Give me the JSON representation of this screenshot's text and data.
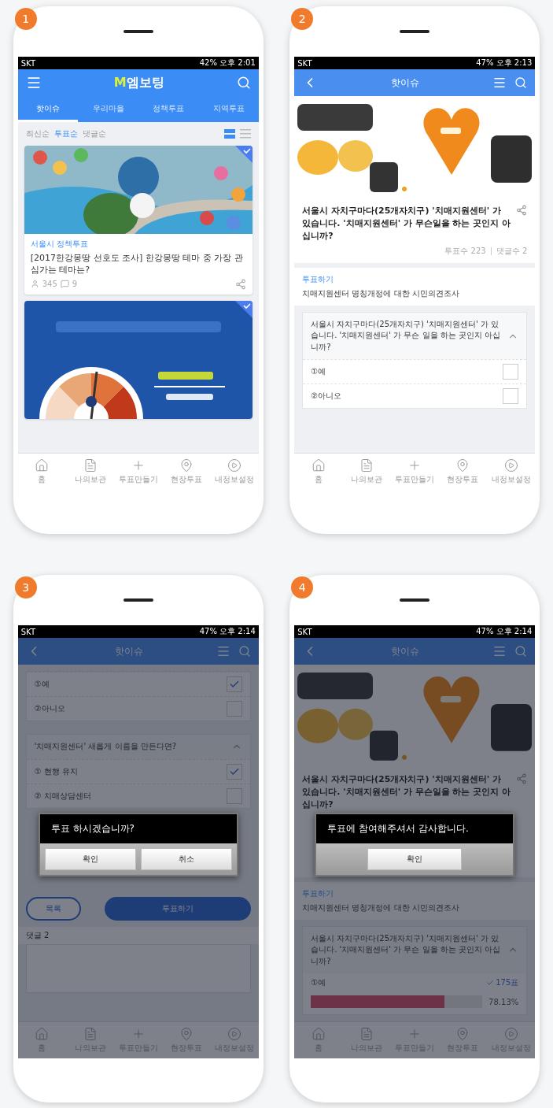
{
  "phones": [
    {
      "number": "1",
      "kind": "list",
      "status_bar": {
        "carrier": "SKT",
        "info": "42% 오후 2:01"
      },
      "app_bar": {
        "logo_mark": "M",
        "logo_text": "엠보팅"
      },
      "tabs": [
        {
          "label": "핫이슈",
          "selected": true
        },
        {
          "label": "우리마을",
          "selected": false
        },
        {
          "label": "정책투표",
          "selected": false
        },
        {
          "label": "지역투표",
          "selected": false
        }
      ],
      "sort_options": [
        {
          "label": "최신순",
          "selected": false
        },
        {
          "label": "투표순",
          "selected": true
        },
        {
          "label": "댓글순",
          "selected": false
        }
      ],
      "view_modes": [
        {
          "kind": "card",
          "selected": true
        },
        {
          "kind": "list",
          "selected": false
        }
      ],
      "cards": [
        {
          "kind": "post",
          "checked": true,
          "category": "서울시 정책투표",
          "title": "[2017한강몽땅 선호도 조사] 한강몽땅 테마 중 가장 관심가는 테마는?",
          "votes": "345",
          "comments": "9"
        },
        {
          "kind": "banner",
          "checked": true
        }
      ],
      "nav": [
        "홈",
        "나의보관",
        "투표만들기",
        "현장투표",
        "내정보설정"
      ]
    },
    {
      "number": "2",
      "kind": "detail",
      "status_bar": {
        "carrier": "SKT",
        "info": "47% 오후 2:13"
      },
      "app_bar": {
        "title": "핫이슈"
      },
      "article": {
        "title": "서울시 자치구마다(25개자치구) '치매지원센터' 가 있습니다. '치매지원센터' 가 무슨일을 하는 곳인지 아십니까?",
        "votes": "투표수 223",
        "comments": "댓글수 2"
      },
      "survey": {
        "label": "투표하기",
        "title": "치매지원센터 명칭개정에 대한 시민의견조사"
      },
      "questions": [
        {
          "text": "서울시 자치구마다(25개자치구) '치매지원센터' 가 있습니다. '치매지원센터' 가 무슨 일을 하는 곳인지 아십니까?",
          "expanded": true,
          "options": [
            {
              "label": "①예",
              "checked": false
            },
            {
              "label": "②아니오",
              "checked": false
            }
          ]
        }
      ],
      "nav": [
        "홈",
        "나의보관",
        "투표만들기",
        "현장투표",
        "내정보설정"
      ]
    },
    {
      "number": "3",
      "kind": "vote",
      "status_bar": {
        "carrier": "SKT",
        "info": "47% 오후 2:14"
      },
      "app_bar": {
        "title": "핫이슈"
      },
      "questions": [
        {
          "options": [
            {
              "label": "①예",
              "checked": true
            },
            {
              "label": "②아니오",
              "checked": false
            }
          ]
        },
        {
          "text": "'치매지원센터' 새롭게 이름을 만든다면?",
          "expanded": true,
          "options": [
            {
              "label": "① 현행 유지",
              "checked": true
            },
            {
              "label": "② 치매상담센터",
              "checked": false
            }
          ]
        }
      ],
      "buttons": [
        {
          "label": "목록",
          "kind": "outline"
        },
        {
          "label": "투표하기",
          "kind": "primary"
        }
      ],
      "comments": {
        "title": "댓글 2"
      },
      "dialog": {
        "message": "투표 하시겠습니까?",
        "buttons": [
          "확인",
          "취소"
        ]
      },
      "nav": [
        "홈",
        "나의보관",
        "투표만들기",
        "현장투표",
        "내정보설정"
      ]
    },
    {
      "number": "4",
      "kind": "result",
      "status_bar": {
        "carrier": "SKT",
        "info": "47% 오후 2:14"
      },
      "app_bar": {
        "title": "핫이슈"
      },
      "article": {
        "title": "서울시 자치구마다(25개자치구) '치매지원센터' 가 있습니다. '치매지원센터' 가 무슨일을 하는 곳인지 아십니까?"
      },
      "survey": {
        "label": "투표하기",
        "title": "치매지원센터 명칭개정에 대한 시민의견조사"
      },
      "questions": [
        {
          "text": "서울시 자치구마다(25개자치구) '치매지원센터' 가 있습니다. '치매지원센터' 가 무슨 일을 하는 곳인지 아십니까?",
          "expanded": true,
          "results": [
            {
              "label": "①예",
              "count": "175표",
              "percent": "78.13%",
              "level": 0.7813
            }
          ]
        }
      ],
      "dialog": {
        "message": "투표에 참여해주셔서 감사합니다.",
        "buttons": [
          "확인"
        ]
      },
      "nav": [
        "홈",
        "나의보관",
        "투표만들기",
        "현장투표",
        "내정보설정"
      ]
    }
  ]
}
